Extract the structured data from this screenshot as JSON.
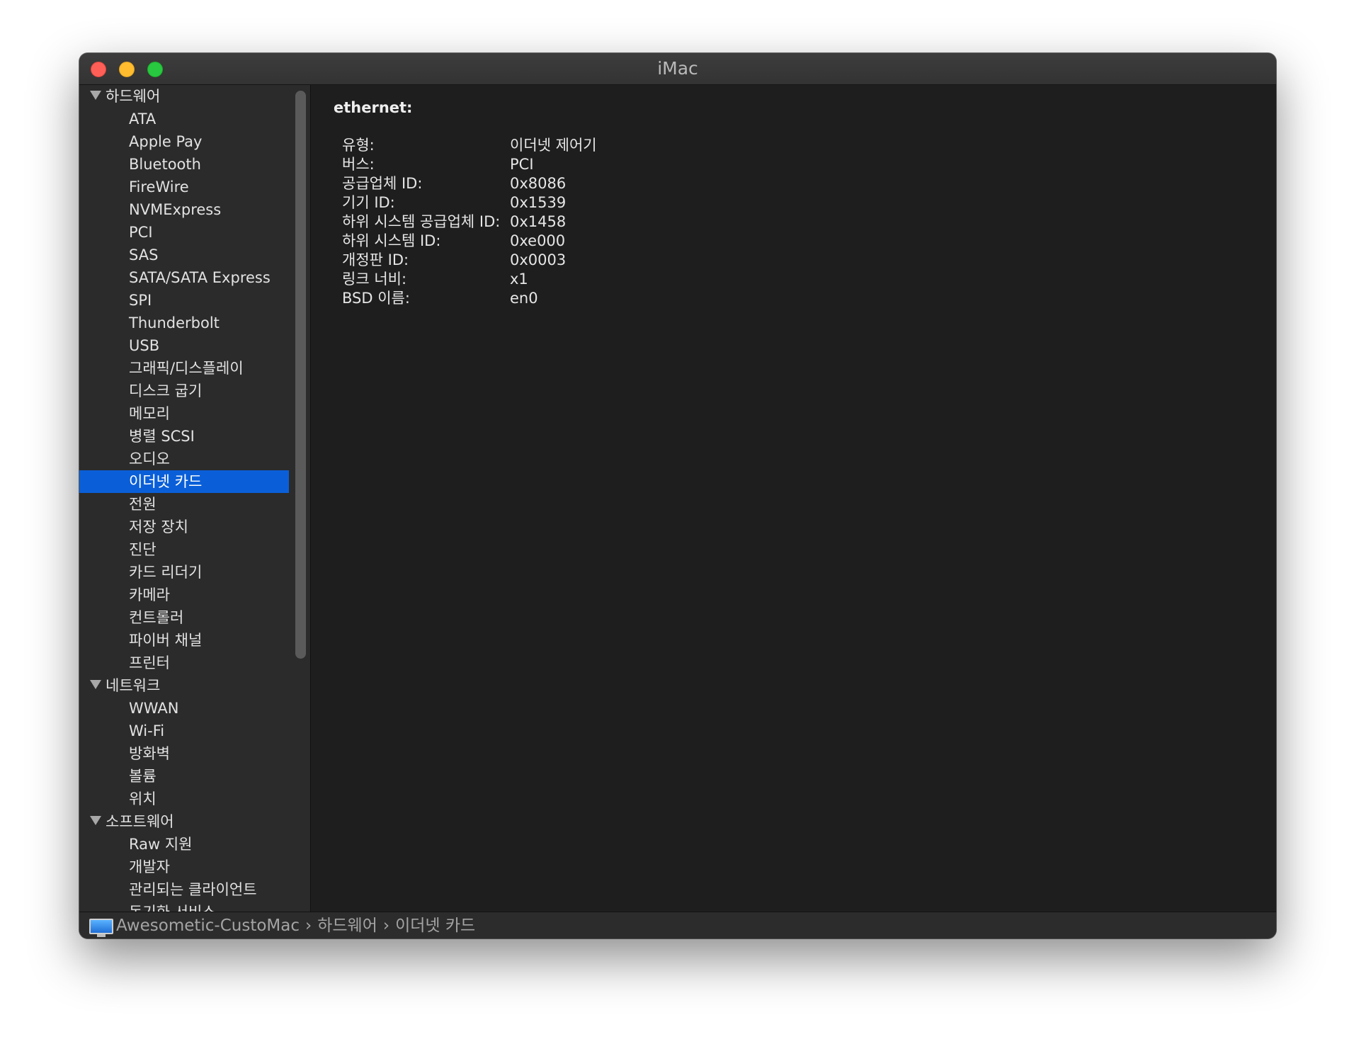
{
  "window": {
    "title": "iMac"
  },
  "sidebar": {
    "groups": [
      {
        "label": "하드웨어",
        "items": [
          "ATA",
          "Apple Pay",
          "Bluetooth",
          "FireWire",
          "NVMExpress",
          "PCI",
          "SAS",
          "SATA/SATA Express",
          "SPI",
          "Thunderbolt",
          "USB",
          "그래픽/디스플레이",
          "디스크 굽기",
          "메모리",
          "병렬 SCSI",
          "오디오",
          "이더넷 카드",
          "전원",
          "저장 장치",
          "진단",
          "카드 리더기",
          "카메라",
          "컨트롤러",
          "파이버 채널",
          "프린터"
        ]
      },
      {
        "label": "네트워크",
        "items": [
          "WWAN",
          "Wi-Fi",
          "방화벽",
          "볼륨",
          "위치"
        ]
      },
      {
        "label": "소프트웨어",
        "items": [
          "Raw 지원",
          "개발자",
          "관리되는 클라이언트",
          "동기화 서비스"
        ]
      }
    ],
    "selected": "이더넷 카드"
  },
  "main": {
    "section_title": "ethernet:",
    "properties": [
      {
        "key": "유형:",
        "value": "이더넷 제어기"
      },
      {
        "key": "버스:",
        "value": "PCI"
      },
      {
        "key": "공급업체 ID:",
        "value": "0x8086"
      },
      {
        "key": "기기 ID:",
        "value": "0x1539"
      },
      {
        "key": "하위 시스템 공급업체 ID:",
        "value": "0x1458"
      },
      {
        "key": "하위 시스템 ID:",
        "value": "0xe000"
      },
      {
        "key": "개정판 ID:",
        "value": "0x0003"
      },
      {
        "key": "링크 너비:",
        "value": "x1"
      },
      {
        "key": "BSD 이름:",
        "value": "en0"
      }
    ]
  },
  "statusbar": {
    "icon": "computer-icon",
    "crumbs": [
      "Awesometic-CustoMac",
      "하드웨어",
      "이더넷 카드"
    ],
    "separator": "›"
  },
  "colors": {
    "selection": "#0a5fd8",
    "close": "#ff5f57",
    "minimize": "#febc2e",
    "maximize": "#28c840"
  }
}
